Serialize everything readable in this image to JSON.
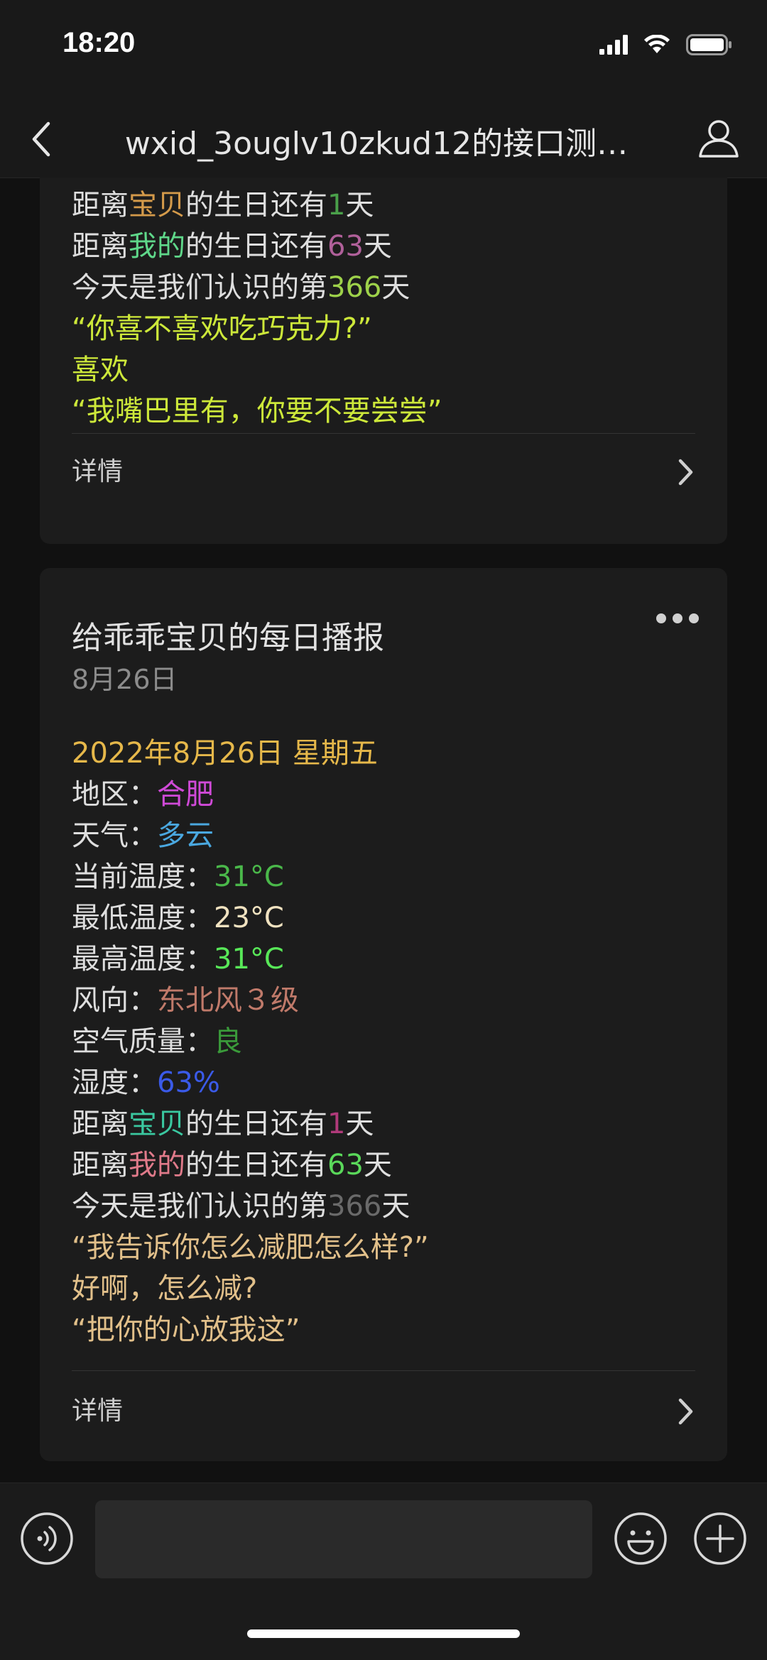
{
  "status": {
    "time": "18:20"
  },
  "nav": {
    "title": "wxid_3ouglv10zkud12的接口测…"
  },
  "card1": {
    "lines": [
      [
        {
          "t": "距离",
          "c": "#dedede"
        },
        {
          "t": "宝贝",
          "c": "#d49a4a"
        },
        {
          "t": "的生日还有",
          "c": "#dedede"
        },
        {
          "t": "1",
          "c": "#4aa04a"
        },
        {
          "t": "天",
          "c": "#dedede"
        }
      ],
      [
        {
          "t": "距离",
          "c": "#dedede"
        },
        {
          "t": "我的",
          "c": "#5fd88a"
        },
        {
          "t": "的生日还有",
          "c": "#dedede"
        },
        {
          "t": "63",
          "c": "#b0609a"
        },
        {
          "t": "天",
          "c": "#dedede"
        }
      ],
      [
        {
          "t": "今天是我们认识的第",
          "c": "#dedede"
        },
        {
          "t": "366",
          "c": "#9ed24a"
        },
        {
          "t": "天",
          "c": "#dedede"
        }
      ],
      [
        {
          "t": "“你喜不喜欢吃巧克力?”",
          "c": "#cde83a"
        }
      ],
      [
        {
          "t": "喜欢",
          "c": "#cde83a"
        }
      ],
      [
        {
          "t": "“我嘴巴里有，你要不要尝尝”",
          "c": "#cde83a"
        }
      ]
    ],
    "detail_label": "详情"
  },
  "card2": {
    "title": "给乖乖宝贝的每日播报",
    "date": "8月26日",
    "lines": [
      [
        {
          "t": "2022年8月26日  星期五",
          "c": "#e6b84a"
        }
      ],
      [
        {
          "t": "地区：",
          "c": "#dedede"
        },
        {
          "t": "合肥",
          "c": "#d04ad8"
        }
      ],
      [
        {
          "t": "天气：",
          "c": "#dedede"
        },
        {
          "t": "多云",
          "c": "#4aa8e0"
        }
      ],
      [
        {
          "t": "当前温度：",
          "c": "#dedede"
        },
        {
          "t": "31°C",
          "c": "#4ab84a"
        }
      ],
      [
        {
          "t": "最低温度：",
          "c": "#dedede"
        },
        {
          "t": "23°C",
          "c": "#f0e2c0"
        }
      ],
      [
        {
          "t": "最高温度：",
          "c": "#dedede"
        },
        {
          "t": "31°C",
          "c": "#58e858"
        }
      ],
      [
        {
          "t": "风向：",
          "c": "#dedede"
        },
        {
          "t": "东北风３级",
          "c": "#c07a6a"
        }
      ],
      [
        {
          "t": "空气质量：",
          "c": "#dedede"
        },
        {
          "t": "良",
          "c": "#3a9a3a"
        }
      ],
      [
        {
          "t": "湿度：",
          "c": "#dedede"
        },
        {
          "t": "63%",
          "c": "#3a5ae8"
        }
      ],
      [
        {
          "t": "距离",
          "c": "#dedede"
        },
        {
          "t": "宝贝",
          "c": "#3ac8a0"
        },
        {
          "t": "的生日还有",
          "c": "#dedede"
        },
        {
          "t": "1",
          "c": "#b03a7a"
        },
        {
          "t": "天",
          "c": "#dedede"
        }
      ],
      [
        {
          "t": "距离",
          "c": "#dedede"
        },
        {
          "t": "我的",
          "c": "#e07a8a"
        },
        {
          "t": "的生日还有",
          "c": "#dedede"
        },
        {
          "t": "63",
          "c": "#5ad85a"
        },
        {
          "t": "天",
          "c": "#dedede"
        }
      ],
      [
        {
          "t": "今天是我们认识的第",
          "c": "#dedede"
        },
        {
          "t": "366",
          "c": "#6a6a6a"
        },
        {
          "t": "天",
          "c": "#dedede"
        }
      ],
      [
        {
          "t": "“我告诉你怎么减肥怎么样?”",
          "c": "#e2c08a"
        }
      ],
      [
        {
          "t": "好啊，怎么减?",
          "c": "#e2c08a"
        }
      ],
      [
        {
          "t": "“把你的心放我这”",
          "c": "#e2c08a"
        }
      ]
    ],
    "detail_label": "详情"
  },
  "icons": [
    "signal-icon",
    "wifi-icon",
    "battery-icon",
    "back-icon",
    "user-icon",
    "more-icon",
    "chevron-right-icon",
    "voice-icon",
    "emoji-icon",
    "plus-icon"
  ]
}
